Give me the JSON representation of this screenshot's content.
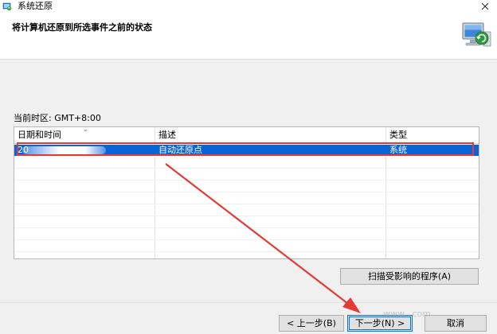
{
  "window": {
    "title": "系统还原",
    "header_text": "将计算机还原到所选事件之前的状态"
  },
  "timezone_label": "当前时区: GMT+8:00",
  "table": {
    "columns": [
      "日期和时间",
      "描述",
      "类型"
    ],
    "rows": [
      {
        "datetime": "20",
        "description": "自动还原点",
        "type": "系统",
        "selected": true
      }
    ]
  },
  "buttons": {
    "scan": "扫描受影响的程序(A)",
    "back": "< 上一步(B)",
    "next": "下一步(N) >",
    "cancel": "取消"
  },
  "watermark": "www.         .com",
  "colors": {
    "selection": "#0a64d6",
    "annotation": "#e53935"
  }
}
